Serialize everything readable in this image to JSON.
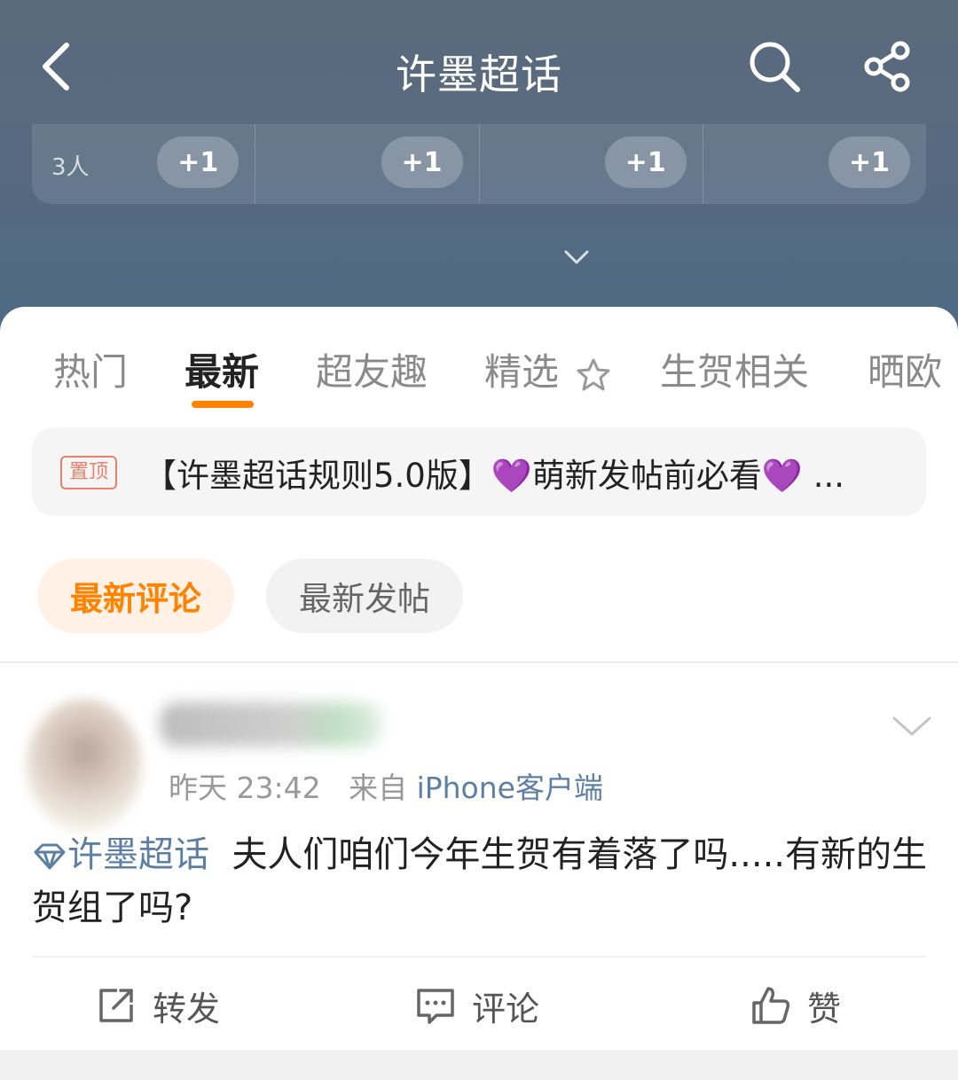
{
  "navbar": {
    "title": "许墨超话",
    "back_icon": "chevron-left-icon",
    "search_icon": "search-icon",
    "share_icon": "share-icon"
  },
  "stats": {
    "cells": [
      {
        "count": "3人",
        "button": "+1"
      },
      {
        "count": "",
        "button": "+1"
      },
      {
        "count": "",
        "button": "+1"
      },
      {
        "count": "",
        "button": "+1"
      }
    ]
  },
  "tabs": [
    {
      "label": "热门"
    },
    {
      "label": "最新"
    },
    {
      "label": "超友趣"
    },
    {
      "label": "精选"
    },
    {
      "label": "生贺相关"
    },
    {
      "label": "晒欧"
    }
  ],
  "active_tab": "最新",
  "pinned": {
    "badge": "置顶",
    "text": "【许墨超话规则5.0版】💜萌新发帖前必看💜 ..."
  },
  "filters": {
    "active": "最新评论",
    "inactive": "最新发帖"
  },
  "post": {
    "time": "昨天 23:42",
    "source_prefix": "来自",
    "source": "iPhone客户端",
    "topic": "许墨超话",
    "text": "夫人们咱们今年生贺有着落了吗.....有新的生贺组了吗?",
    "actions": {
      "repost": "转发",
      "comment": "评论",
      "like": "赞"
    }
  },
  "colors": {
    "accent": "#ff8200",
    "link": "#5d7fa3",
    "header_bg": "#5a6b80"
  }
}
